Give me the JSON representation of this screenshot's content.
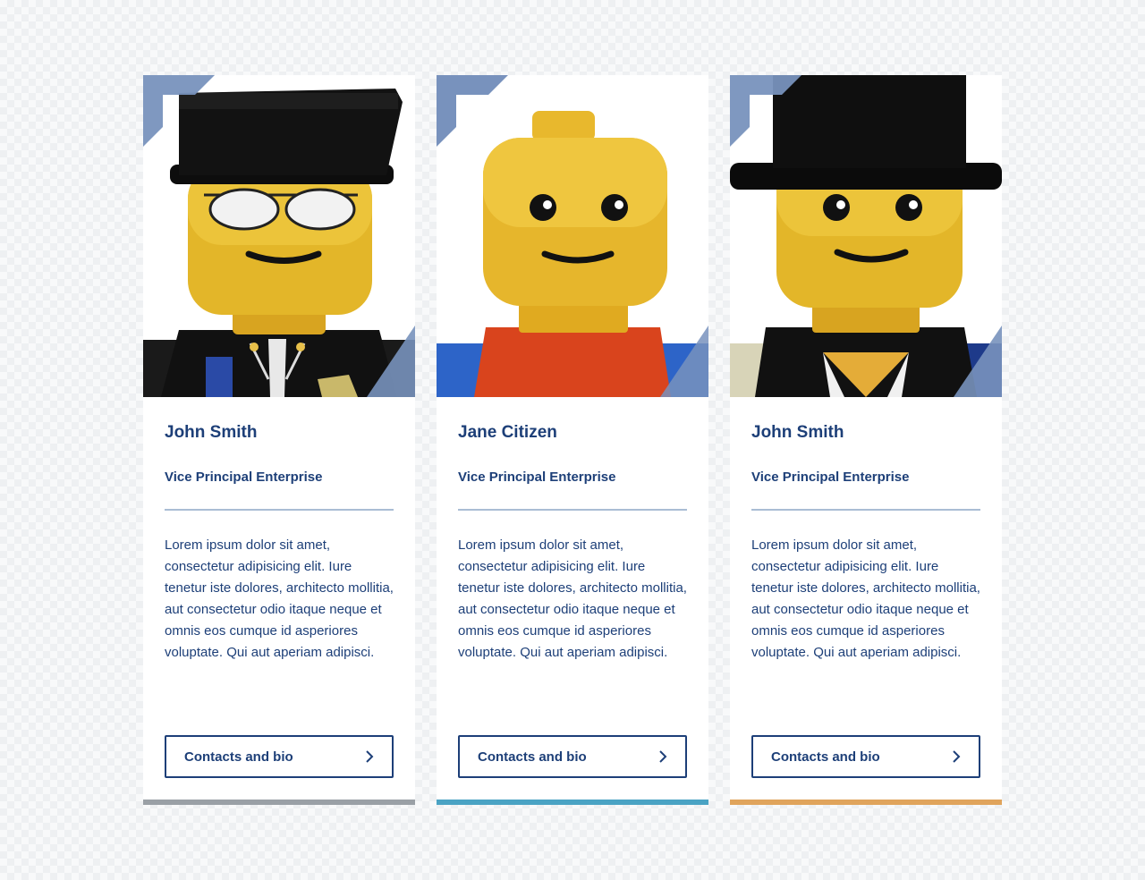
{
  "cards": [
    {
      "name": "John Smith",
      "role": "Vice Principal Enterprise",
      "bio": "Lorem ipsum dolor sit amet, consectetur adipisicing elit. Iure tenetur iste dolores, architecto mollitia, aut consectetur odio itaque neque et omnis eos cumque id asperiores voluptate. Qui aut aperiam adipisci.",
      "button_label": "Contacts and bio",
      "button_icon": "chevron-right-icon",
      "image": "lego-minifig-mortarboard-glasses",
      "accent_color": "#9aa0a6"
    },
    {
      "name": "Jane Citizen",
      "role": "Vice Principal Enterprise",
      "bio": "Lorem ipsum dolor sit amet, consectetur adipisicing elit. Iure tenetur iste dolores, architecto mollitia, aut consectetur odio itaque neque et omnis eos cumque id asperiores voluptate. Qui aut aperiam adipisci.",
      "button_label": "Contacts and bio",
      "button_icon": "chevron-right-icon",
      "image": "lego-minifig-classic-smile",
      "accent_color": "#4aa3c4"
    },
    {
      "name": "John Smith",
      "role": "Vice Principal Enterprise",
      "bio": "Lorem ipsum dolor sit amet, consectetur adipisicing elit. Iure tenetur iste dolores, architecto mollitia, aut consectetur odio itaque neque et omnis eos cumque id asperiores voluptate. Qui aut aperiam adipisci.",
      "button_label": "Contacts and bio",
      "button_icon": "chevron-right-icon",
      "image": "lego-minifig-top-hat",
      "accent_color": "#e0a45c"
    }
  ],
  "colors": {
    "text_primary": "#1d3f78",
    "divider": "#a9bdd4",
    "corner_accent": "#7892bd"
  }
}
